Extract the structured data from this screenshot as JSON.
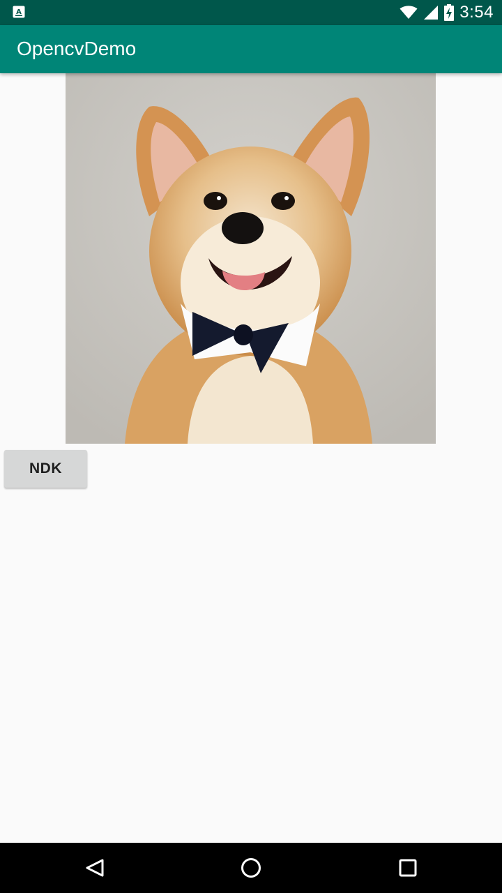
{
  "status_bar": {
    "time": "3:54",
    "icons": [
      "app-notification-icon",
      "wifi-icon",
      "cell-signal-icon",
      "battery-charging-icon"
    ],
    "background": "#00574b"
  },
  "app_bar": {
    "title": "OpencvDemo",
    "background": "#008577"
  },
  "main": {
    "image": {
      "subject": "corgi-with-bowtie-photo"
    },
    "ndk_button_label": "NDK"
  },
  "nav_bar": {
    "icons": [
      "back-icon",
      "home-icon",
      "recents-icon"
    ]
  }
}
